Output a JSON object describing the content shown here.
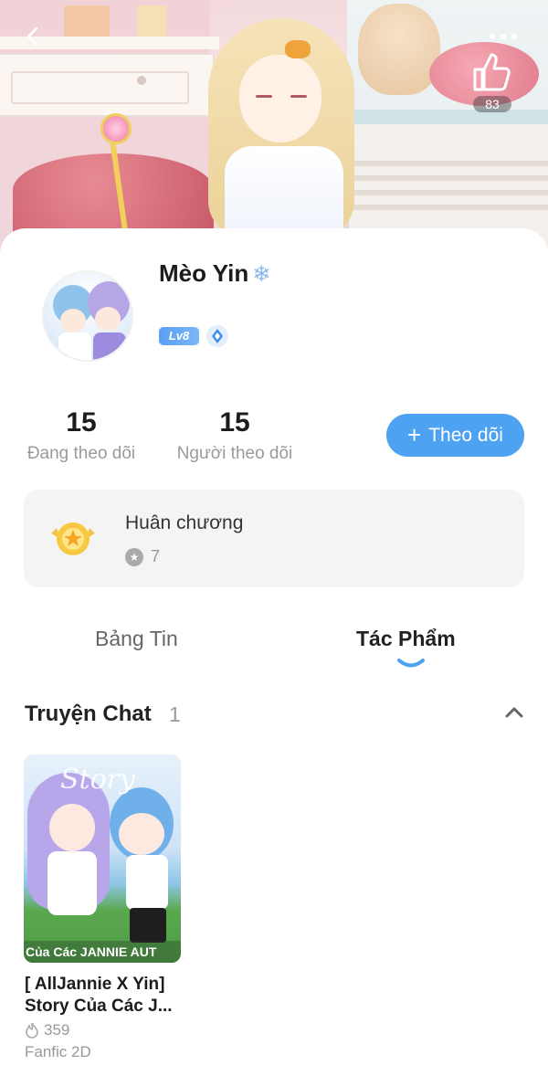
{
  "header": {
    "back_icon": "chevron-left-icon",
    "more_icon": "more-dots-icon",
    "like_icon": "thumbs-up-icon",
    "like_count": "83"
  },
  "profile": {
    "name": "Mèo Yin",
    "name_emoji": "❄",
    "level": "Lv8",
    "rank_icon": "diamond-badge-icon"
  },
  "stats": {
    "following_count": "15",
    "following_label": "Đang theo dõi",
    "followers_count": "15",
    "followers_label": "Người theo dõi"
  },
  "follow_button": {
    "plus": "+",
    "label": "Theo dõi",
    "color": "#4ea2f2"
  },
  "medals": {
    "title": "Huân chương",
    "count": "7",
    "icon": "medal-icon"
  },
  "tabs": [
    {
      "label": "Bảng Tin",
      "active": false
    },
    {
      "label": "Tác Phẩm",
      "active": true
    }
  ],
  "section": {
    "title": "Truyện Chat",
    "count": "1",
    "collapse_icon": "chevron-up-icon"
  },
  "stories": [
    {
      "cover_text": "Story",
      "cover_banner": "Của Các JANNIE AUT",
      "title_line1": "[ AllJannie X Yin]",
      "title_line2": "Story Của Các J...",
      "reads": "359",
      "category": "Fanfic 2D"
    }
  ]
}
